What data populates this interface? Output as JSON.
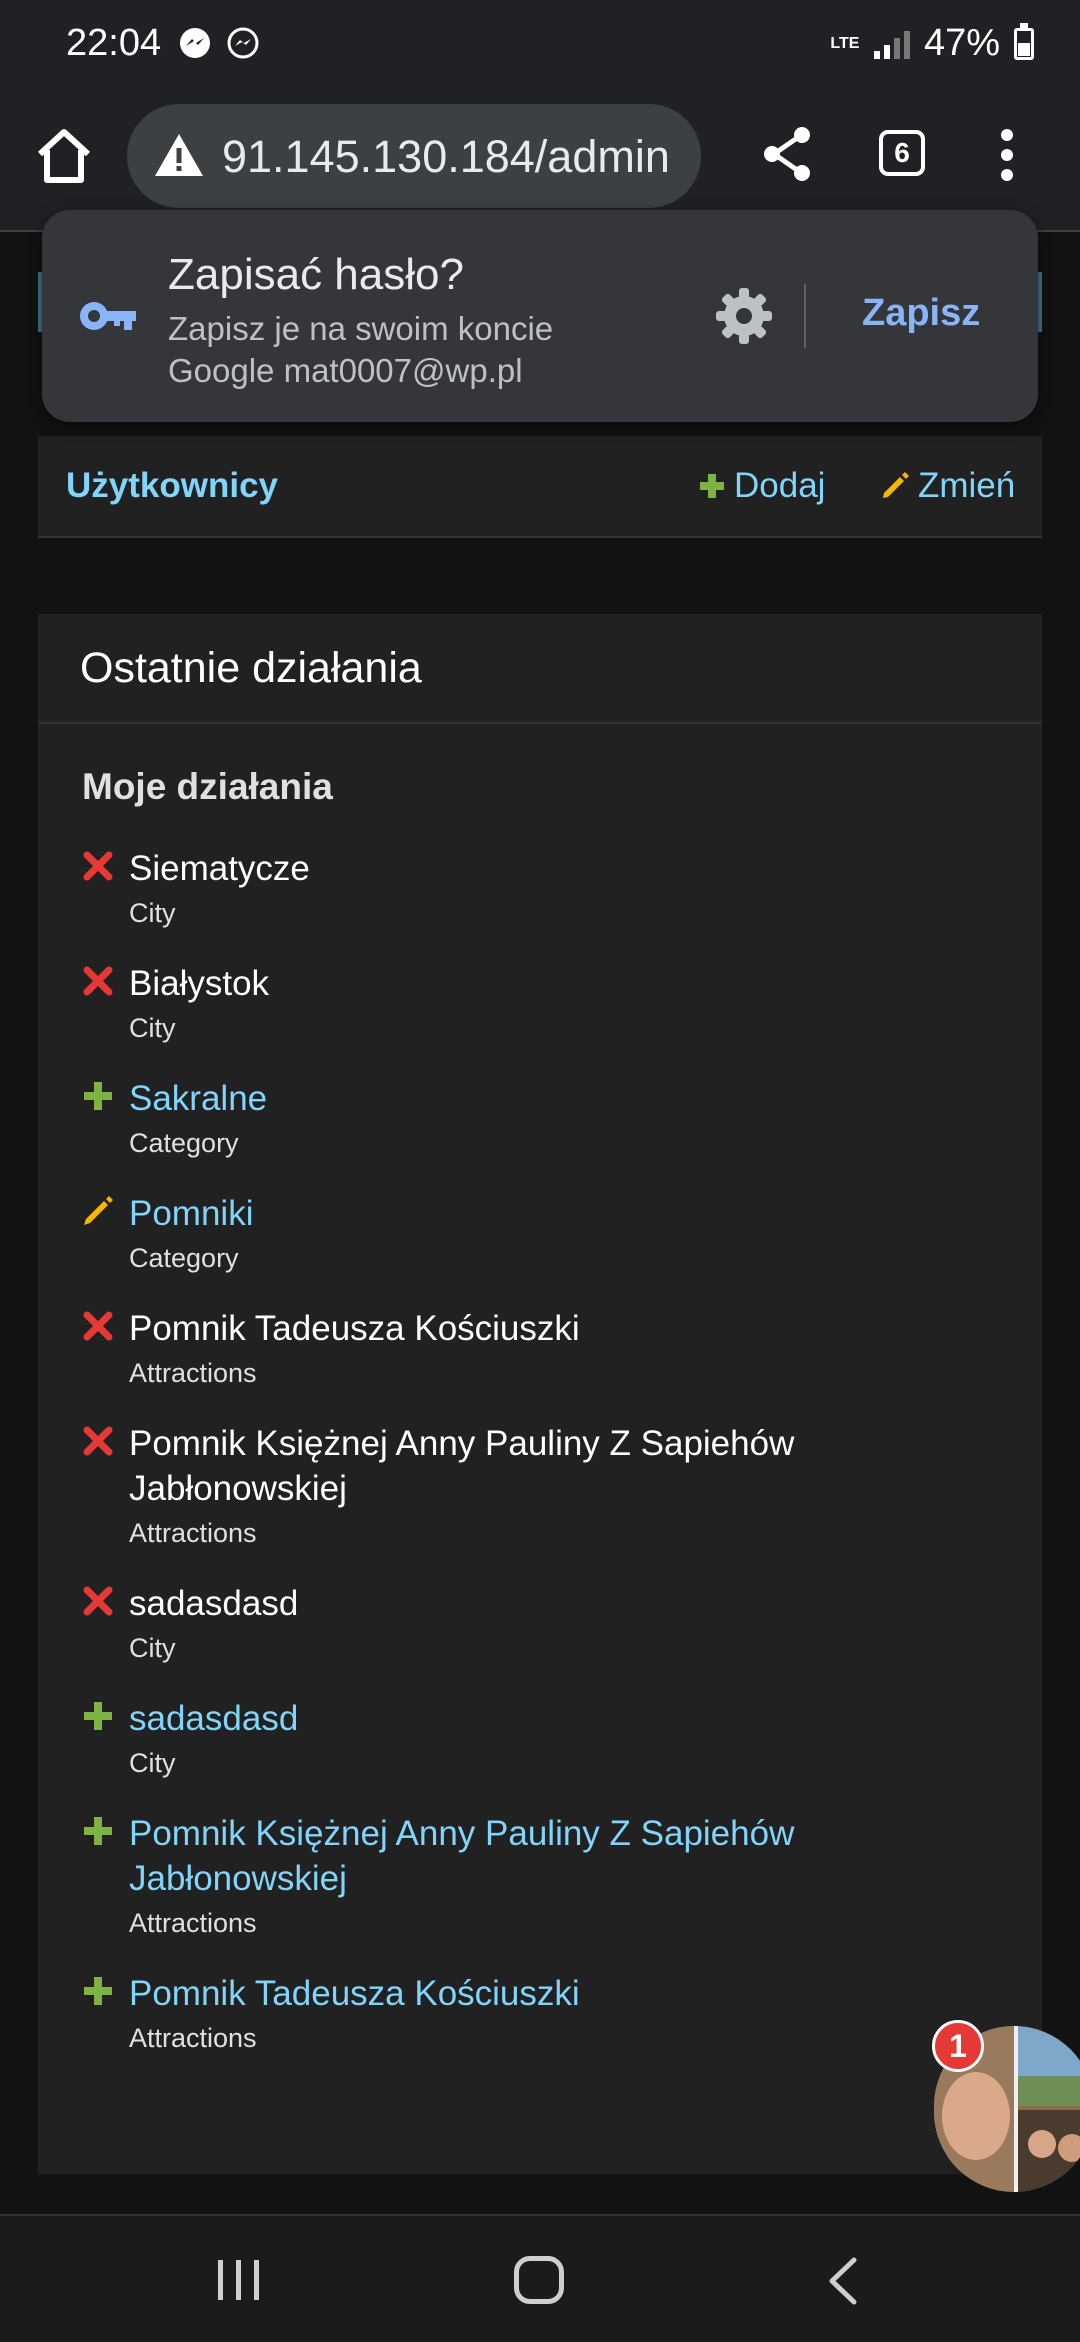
{
  "status_bar": {
    "time": "22:04",
    "network": "LTE",
    "battery": "47%",
    "battery_level": 0.47
  },
  "browser": {
    "url": "91.145.130.184/admin",
    "tab_count": "6"
  },
  "password_prompt": {
    "title": "Zapisać hasło?",
    "subtitle": "Zapisz je na swoim koncie Google mat0007@wp.pl",
    "save_label": "Zapisz"
  },
  "users_row": {
    "label": "Użytkownicy",
    "add_label": "Dodaj",
    "change_label": "Zmień"
  },
  "recent_actions": {
    "title": "Ostatnie działania",
    "my_actions_title": "Moje działania",
    "items": [
      {
        "action": "delete",
        "name": "Siematycze",
        "type": "City"
      },
      {
        "action": "delete",
        "name": "Białystok",
        "type": "City"
      },
      {
        "action": "add",
        "name": "Sakralne",
        "type": "Category"
      },
      {
        "action": "change",
        "name": "Pomniki",
        "type": "Category"
      },
      {
        "action": "delete",
        "name": "Pomnik Tadeusza Kościuszki",
        "type": "Attractions"
      },
      {
        "action": "delete",
        "name": "Pomnik Księżnej Anny Pauliny Z Sapiehów Jabłonowskiej",
        "type": "Attractions"
      },
      {
        "action": "delete",
        "name": "sadasdasd",
        "type": "City"
      },
      {
        "action": "add",
        "name": "sadasdasd",
        "type": "City"
      },
      {
        "action": "add",
        "name": "Pomnik Księżnej Anny Pauliny Z Sapiehów Jabłonowskiej",
        "type": "Attractions"
      },
      {
        "action": "add",
        "name": "Pomnik Tadeusza Kościuszki",
        "type": "Attractions"
      }
    ]
  },
  "chat_head": {
    "badge": "1"
  },
  "colors": {
    "link": "#81d4fa",
    "add": "#7cb342",
    "change": "#f5b800",
    "delete": "#e53935",
    "prompt_accent": "#8ab4f8"
  }
}
